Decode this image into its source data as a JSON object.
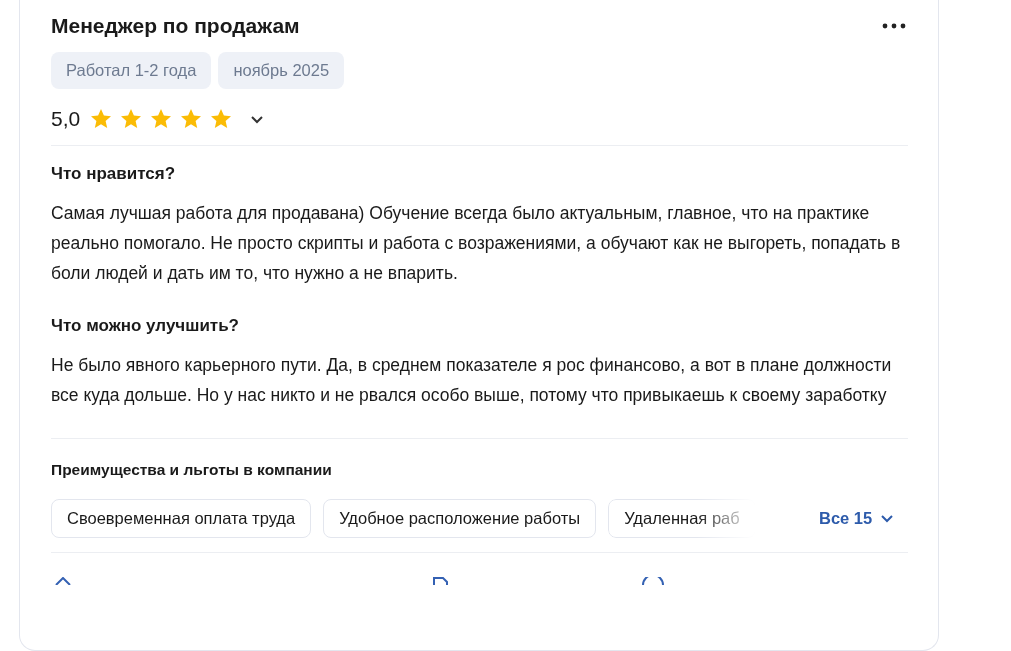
{
  "review": {
    "title": "Менеджер по продажам",
    "tags": [
      "Работал 1-2 года",
      "ноябрь 2025"
    ],
    "rating": "5,0",
    "stars": 5,
    "sections": [
      {
        "heading": "Что нравится?",
        "text": "Самая лучшая работа для продавана) Обучение всегда было актуальным, главное, что на практике реально помогало. Не просто скрипты и работа с возражениями, а обучают как не выгореть, попадать в боли людей и дать им то, что нужно а не впарить."
      },
      {
        "heading": "Что можно улучшить?",
        "text": "Не было явного карьерного пути. Да, в среднем показателе я рос финансово, а вот в плане должности все куда дольше. Но у нас никто и не рвался особо выше, потому что привыкаешь к своему заработку"
      }
    ],
    "benefits": {
      "heading": "Преимущества и льготы в компании",
      "chips": [
        "Своевременная оплата труда",
        "Удобное расположение работы",
        "Удаленная раб"
      ],
      "more": "Все 15"
    }
  }
}
